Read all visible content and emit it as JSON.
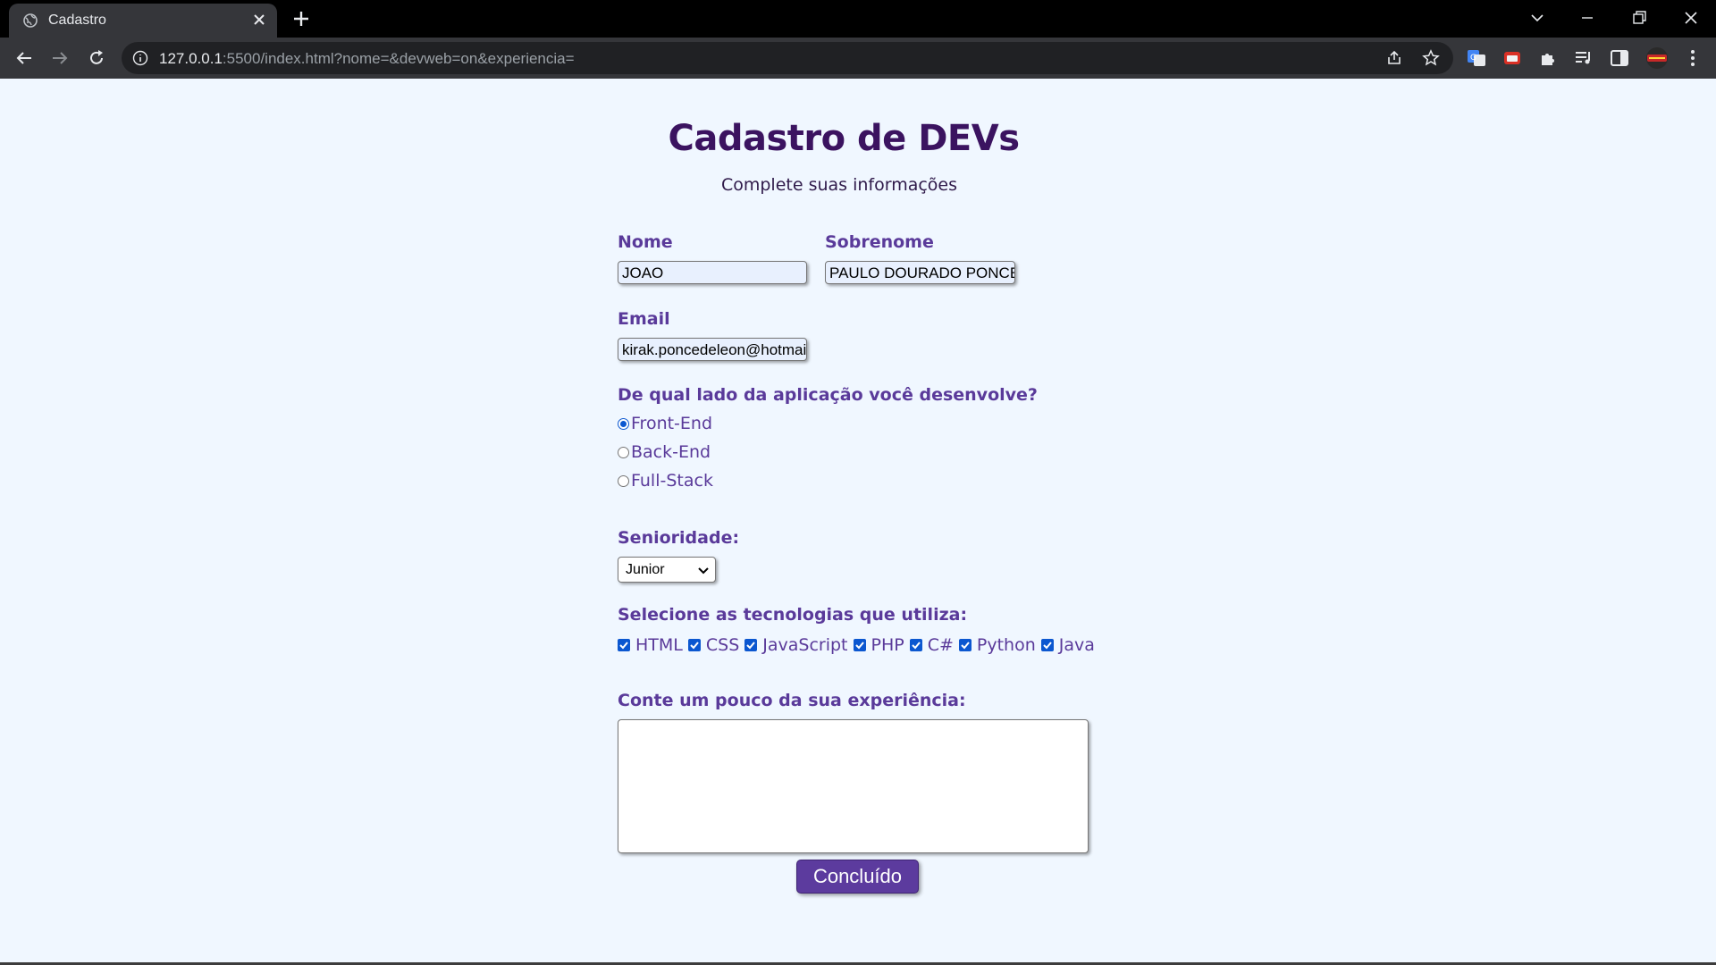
{
  "browser": {
    "tab_title": "Cadastro",
    "url_host": "127.0.0.1",
    "url_rest": ":5500/index.html?nome=&devweb=on&experiencia="
  },
  "page": {
    "title": "Cadastro de DEVs",
    "subtitle": "Complete suas informações"
  },
  "form": {
    "nome_label": "Nome",
    "nome_value": "JOAO",
    "sobrenome_label": "Sobrenome",
    "sobrenome_value": "PAULO DOURADO PONCE",
    "email_label": "Email",
    "email_value": "kirak.poncedeleon@hotmai",
    "side_question": "De qual lado da aplicação você desenvolve?",
    "side_options": [
      {
        "label": "Front-End",
        "checked": true
      },
      {
        "label": "Back-End",
        "checked": false
      },
      {
        "label": "Full-Stack",
        "checked": false
      }
    ],
    "seniority_label": "Senioridade:",
    "seniority_value": "Junior",
    "tech_label": "Selecione as tecnologias que utiliza:",
    "techs": [
      {
        "label": "HTML",
        "checked": true
      },
      {
        "label": "CSS",
        "checked": true
      },
      {
        "label": "JavaScript",
        "checked": true
      },
      {
        "label": "PHP",
        "checked": true
      },
      {
        "label": "C#",
        "checked": true
      },
      {
        "label": "Python",
        "checked": true
      },
      {
        "label": "Java",
        "checked": true
      }
    ],
    "experience_label": "Conte um pouco da sua experiência:",
    "experience_value": "",
    "submit_label": "Concluído"
  }
}
